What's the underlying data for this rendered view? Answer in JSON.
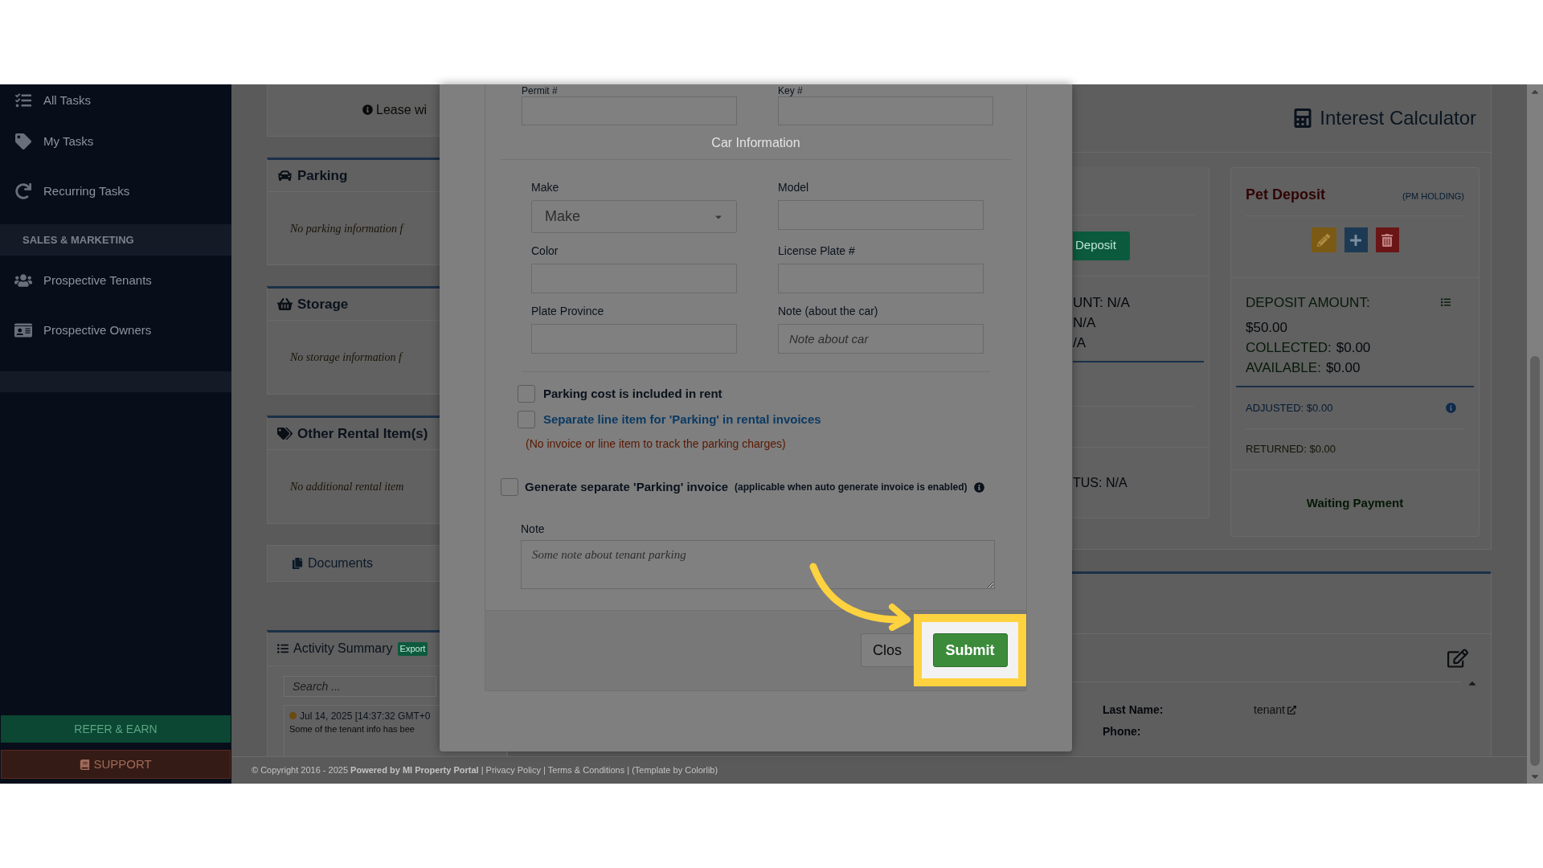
{
  "sidebar": {
    "items": [
      {
        "kind": "link",
        "label": "All Tasks"
      },
      {
        "kind": "link",
        "label": "My Tasks"
      },
      {
        "kind": "link",
        "label": "Recurring Tasks"
      },
      {
        "kind": "section",
        "label": "SALES & MARKETING"
      },
      {
        "kind": "link",
        "label": "Prospective Tenants"
      },
      {
        "kind": "link",
        "label": "Prospective Owners"
      },
      {
        "kind": "band"
      }
    ],
    "refer_button": "REFER & EARN",
    "support_button": "SUPPORT"
  },
  "left_column": {
    "lease_note": "Lease wi",
    "panels": [
      {
        "kind": "parking",
        "title": "Parking",
        "note": "No parking information f"
      },
      {
        "kind": "storage",
        "title": "Storage",
        "note": "No storage information f"
      },
      {
        "kind": "other",
        "title": "Other Rental Item(s)",
        "note": "No additional rental item"
      },
      {
        "kind": "documents",
        "title": "Documents"
      }
    ],
    "activity": {
      "title": "Activity Summary",
      "export": "Export",
      "search_placeholder": "Search ...",
      "entries": [
        {
          "date": "Jul 14, 2025 [14:37:32 GMT+0",
          "text": "Some of the tenant info has bee"
        }
      ]
    }
  },
  "modal": {
    "top_fields": [
      {
        "label": "Permit #"
      },
      {
        "label": "Key #"
      }
    ],
    "section_title": "Car Information",
    "fields": [
      {
        "kind": "select",
        "label": "Make",
        "placeholder": "Make"
      },
      {
        "kind": "text",
        "label": "Model"
      },
      {
        "kind": "text",
        "label": "Color"
      },
      {
        "kind": "text",
        "label": "License Plate #"
      },
      {
        "kind": "text",
        "label": "Plate Province"
      },
      {
        "kind": "text",
        "label": "Note (about the car)",
        "placeholder": "Note about car"
      }
    ],
    "options": [
      {
        "kind": "plain",
        "label": "Parking cost is included in rent",
        "checked": false
      },
      {
        "kind": "link",
        "label": "Separate line item for 'Parking' in rental invoices",
        "checked": false
      }
    ],
    "warning": "(No invoice or line item to track the parking charges)",
    "invoice_option": {
      "label": "Generate separate 'Parking' invoice",
      "hint": "(applicable when auto generate invoice is enabled)",
      "checked": false
    },
    "note": {
      "label": "Note",
      "placeholder": "Some note about tenant parking"
    },
    "close_button": "Clos",
    "submit_button": "Submit"
  },
  "right_column": {
    "title": "Interest Calculator",
    "deposit_card": {
      "button": "Deposit",
      "lines": [
        "UNT: N/A",
        "N/A",
        "/A"
      ],
      "status": "TUS: N/A"
    },
    "pet_deposit": {
      "title": "Pet Deposit",
      "holding": "(PM HOLDING)",
      "amounts": [
        {
          "label": "DEPOSIT AMOUNT:",
          "value": "$50.00"
        },
        {
          "label": "COLLECTED:",
          "value": "$0.00"
        },
        {
          "label": "AVAILABLE:",
          "value": "$0.00"
        }
      ],
      "adjusted": "ADJUSTED: $0.00",
      "returned": "RETURNED: $0.00",
      "status": "Waiting Payment"
    },
    "contact": [
      {
        "label": "Last Name:",
        "value": "tenant"
      },
      {
        "label": "Phone:"
      }
    ]
  },
  "footer": "© Copyright 2016 - 2025 **Powered by MI Property Portal** | Privacy Policy | Terms & Conditions | (Template by Colorlib)"
}
